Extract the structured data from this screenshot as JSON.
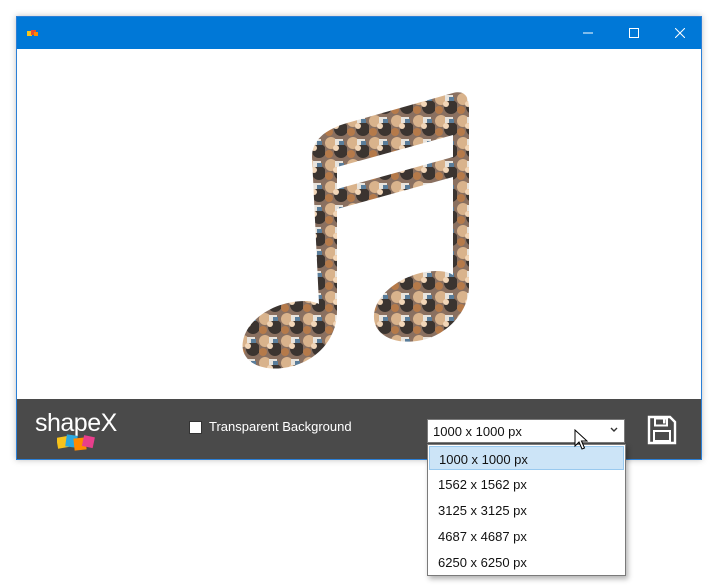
{
  "window": {
    "controls": {
      "minimize": "minimize-icon",
      "maximize": "maximize-icon",
      "close": "close-icon"
    }
  },
  "canvas": {
    "shape": "music-note",
    "fill": "photo-collage"
  },
  "toolbar": {
    "logo_text": "shapeX",
    "transparent_label": "Transparent Background",
    "transparent_checked": false,
    "size_select": {
      "value": "1000 x 1000 px",
      "options": [
        "1000 x 1000 px",
        "1562 x 1562 px",
        "3125 x 3125 px",
        "4687 x 4687 px",
        "6250 x 6250 px"
      ],
      "selected_index": 0
    },
    "save_icon": "save-icon"
  },
  "colors": {
    "titlebar": "#0078d7",
    "toolbar": "#4a4a4a",
    "selected_option": "#cce4f7"
  }
}
